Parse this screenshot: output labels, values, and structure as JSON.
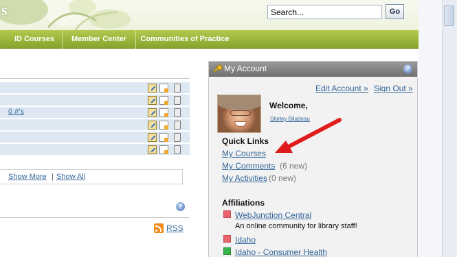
{
  "header": {
    "letter": "s",
    "search": {
      "value": "Search...",
      "placeholder": "Search..."
    },
    "go_label": "Go"
  },
  "nav": {
    "items": [
      {
        "label": "ID Courses"
      },
      {
        "label": "Member Center"
      },
      {
        "label": "Communities of Practice"
      }
    ]
  },
  "list": {
    "rows": [
      {
        "text": ""
      },
      {
        "text": ""
      },
      {
        "text": "0 #'s"
      },
      {
        "text": ""
      },
      {
        "text": ""
      },
      {
        "text": ""
      }
    ],
    "show_more": "Show More",
    "separator": "|",
    "show_all": "Show All",
    "rss": "RSS"
  },
  "account": {
    "title": "My Account",
    "edit_account": "Edit Account »",
    "sign_out": "Sign Out »",
    "welcome": "Welcome,",
    "user_name": "Shirley Biladeau",
    "quick_links_title": "Quick Links",
    "quick_links": [
      {
        "label": "My Courses",
        "count": ""
      },
      {
        "label": "My Comments",
        "count": "(6 new)"
      },
      {
        "label": "My Activities",
        "count": "(0 new)"
      }
    ],
    "affiliations_title": "Affiliations",
    "affiliations": [
      {
        "label": "WebJunction Central",
        "description": "An online community for library staff!"
      },
      {
        "label": "Idaho"
      },
      {
        "label": "Idaho - Consumer Health"
      }
    ]
  },
  "help_glyph": "?",
  "colors": {
    "nav_green": "#9ab73a",
    "link_blue": "#336699",
    "panel_header": "#7f7f7f",
    "row_blue": "#dde8f3",
    "arrow_red": "#e01b1b"
  }
}
